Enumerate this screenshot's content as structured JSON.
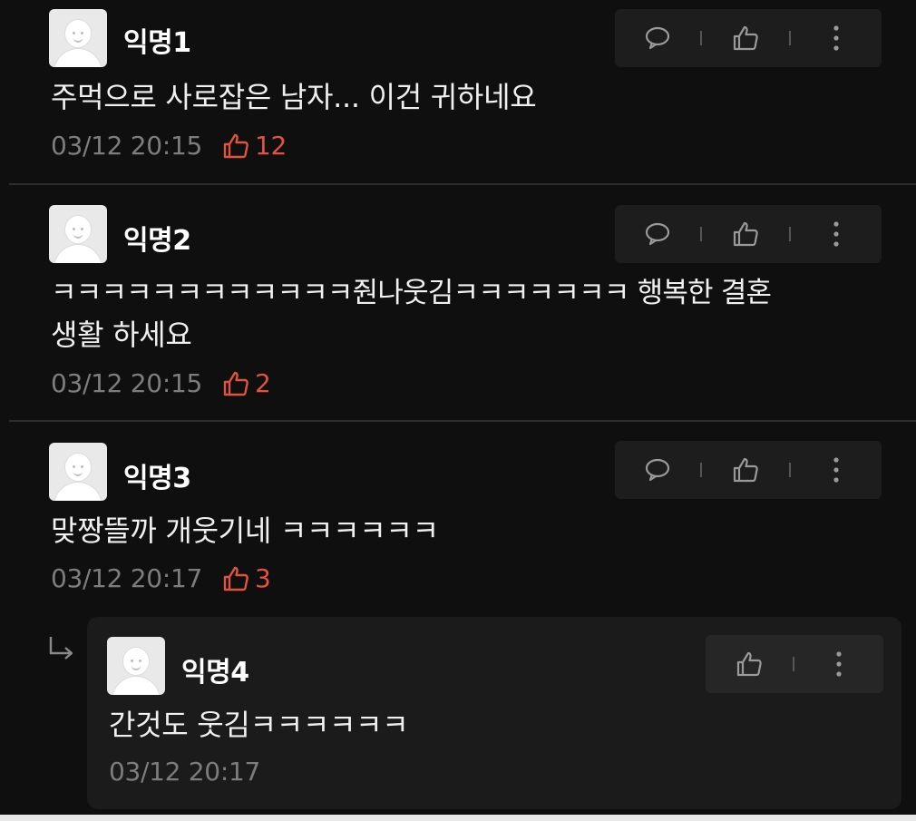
{
  "comments": [
    {
      "nickname": "익명1",
      "text": "주먹으로 사로잡은 남자... 이건 귀하네요",
      "timestamp": "03/12 20:15",
      "likes": "12"
    },
    {
      "nickname": "익명2",
      "text_line1": "ㅋㅋㅋㅋㅋㅋㅋㅋㅋㅋㅋㅋ줜나웃김ㅋㅋㅋㅋㅋㅋㅋ 행복한 결혼",
      "text_line2": "생활 하세요",
      "timestamp": "03/12 20:15",
      "likes": "2"
    },
    {
      "nickname": "익명3",
      "text": "맞짱뜰까 개웃기네 ㅋㅋㅋㅋㅋㅋ",
      "timestamp": "03/12 20:17",
      "likes": "3"
    }
  ],
  "reply": {
    "nickname": "익명4",
    "text": "간것도 웃김ㅋㅋㅋㅋㅋㅋ",
    "timestamp": "03/12 20:17"
  },
  "icons": {
    "comment": "speech-bubble-icon",
    "like": "thumbs-up-icon",
    "more": "vertical-dots-icon",
    "reply": "reply-arrow-icon"
  },
  "colors": {
    "background": "#0f0f0f",
    "like_accent": "#e0533f",
    "meta_text": "#7d7d7d",
    "action_bg": "#1d1d1d"
  }
}
